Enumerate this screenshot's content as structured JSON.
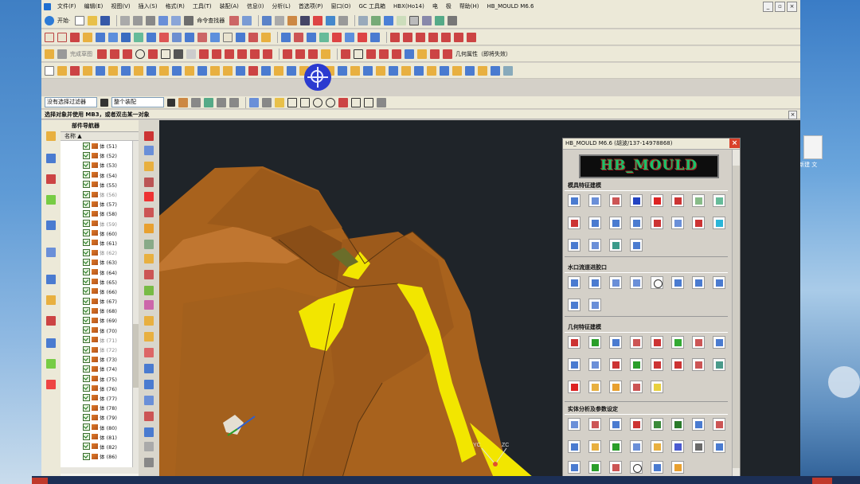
{
  "menu": [
    "文件(F)",
    "编辑(E)",
    "视图(V)",
    "插入(S)",
    "格式(R)",
    "工具(T)",
    "装配(A)",
    "信息(I)",
    "分析(L)",
    "首选项(P)",
    "窗口(O)",
    "GC 工具箱",
    "HBX(Ho14)",
    "电",
    "极",
    "帮助(H)",
    "HB_MOULD M6.6"
  ],
  "toolbar": {
    "start_label": "开始·",
    "command_finder": "命令查找器",
    "complete_sketch": "完成草图",
    "geometry_property": "几何属性（即将失效）",
    "filter_select": "没有选择过滤器",
    "assembly_select": "整个装配"
  },
  "status": {
    "prompt": "选择对象并使用 MB3，或者双击某一对象"
  },
  "navigator": {
    "title": "部件导航器",
    "column": "名称",
    "rows": [
      "体 (51)",
      "体 (52)",
      "体 (53)",
      "体 (54)",
      "体 (55)",
      "体 (56)",
      "体 (57)",
      "体 (58)",
      "体 (59)",
      "体 (60)",
      "体 (61)",
      "体 (62)",
      "体 (63)",
      "体 (64)",
      "体 (65)",
      "体 (66)",
      "体 (67)",
      "体 (68)",
      "体 (69)",
      "体 (70)",
      "体 (71)",
      "体 (72)",
      "体 (73)",
      "体 (74)",
      "体 (75)",
      "体 (76)",
      "体 (77)",
      "体 (78)",
      "体 (79)",
      "体 (80)",
      "体 (81)",
      "体 (82)",
      "体 (86)"
    ]
  },
  "panel": {
    "title": "HB_MOULD M6.6 (胡波/137-14978868)",
    "logo": "HB_MOULD",
    "sections": [
      "模具特征建模",
      "水口流道进胶口",
      "几何特征建模",
      "实体分析及参数设定"
    ]
  },
  "viewport": {
    "axis1": "YC",
    "axis2": "ZC"
  },
  "desktop": {
    "file_label": "新建 文"
  },
  "colors": {
    "part": "#a8621d",
    "highlight": "#f2e600",
    "background": "#1f2429",
    "accent": "#2b3bd0"
  }
}
